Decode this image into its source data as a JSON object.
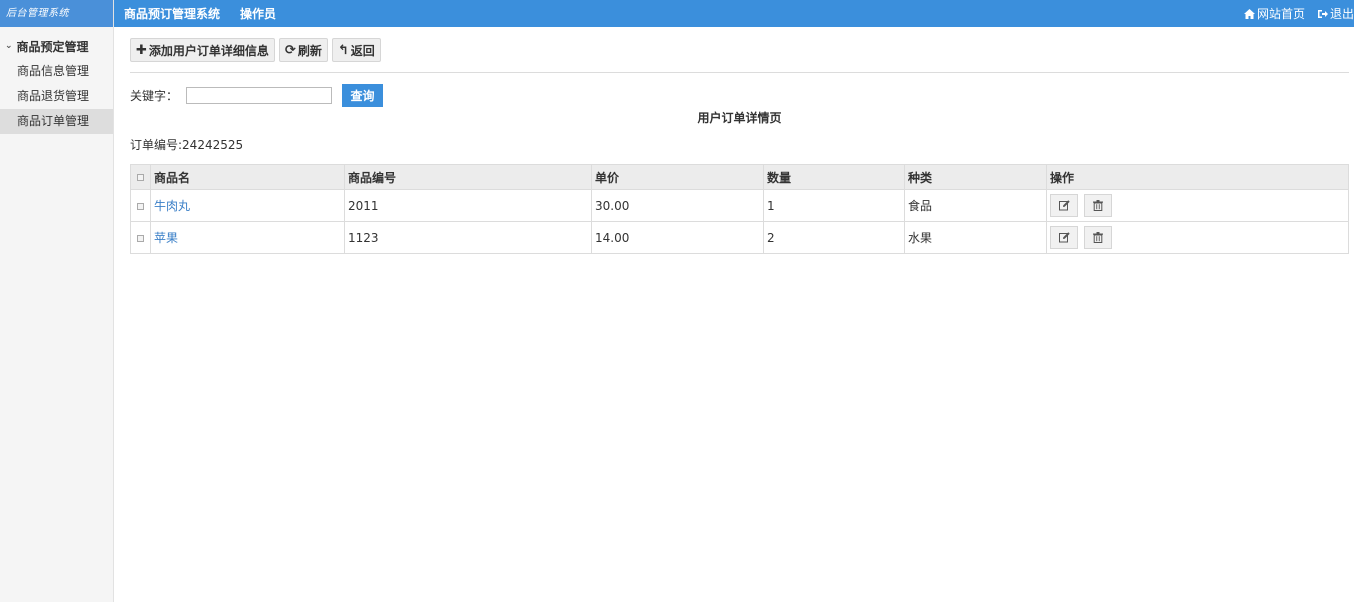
{
  "sidebar": {
    "logo": "后台管理系统",
    "group_label": "商品预定管理",
    "items": [
      {
        "label": "商品信息管理"
      },
      {
        "label": "商品退货管理"
      },
      {
        "label": "商品订单管理"
      }
    ]
  },
  "topbar": {
    "title": "商品预订管理系统",
    "role": "操作员",
    "home_label": "网站首页",
    "logout_label": "退出"
  },
  "toolbar": {
    "add_label": "添加用户订单详细信息",
    "refresh_label": "刷新",
    "back_label": "返回"
  },
  "search": {
    "label": "关键字：",
    "value": "",
    "button_label": "查询"
  },
  "page_title": "用户订单详情页",
  "order_number": "订单编号:24242525",
  "table": {
    "headers": [
      "商品名",
      "商品编号",
      "单价",
      "数量",
      "种类",
      "操作"
    ],
    "rows": [
      {
        "name": "牛肉丸",
        "code": "2011",
        "price": "30.00",
        "qty": "1",
        "category": "食品"
      },
      {
        "name": "苹果",
        "code": "1123",
        "price": "14.00",
        "qty": "2",
        "category": "水果"
      }
    ]
  },
  "colors": {
    "topbar": "#3b8fdc",
    "link": "#3a7fc7",
    "sidebar_bg": "#f5f5f5"
  }
}
